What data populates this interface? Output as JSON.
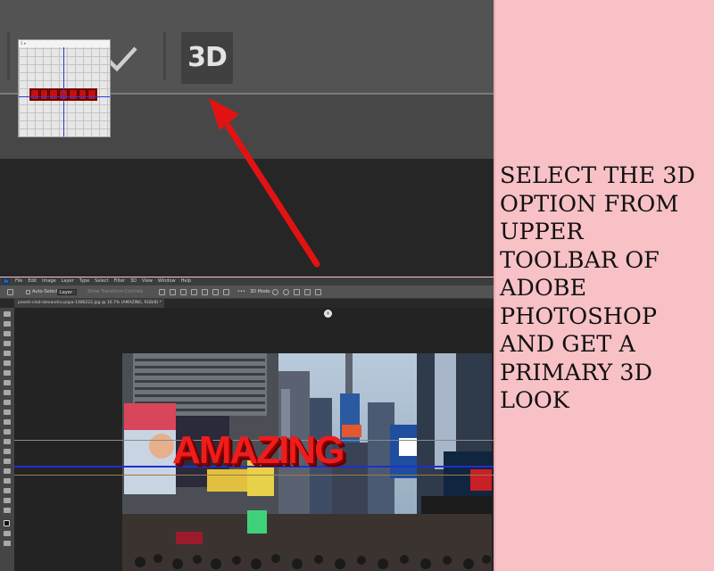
{
  "zoom_toolbar": {
    "btn_3d_label": "3D",
    "cancel_icon": "cancel-circle-icon",
    "commit_icon": "checkmark-icon",
    "arrow_color": "#e31212"
  },
  "photoshop": {
    "menu": [
      "File",
      "Edit",
      "Image",
      "Layer",
      "Type",
      "Select",
      "Filter",
      "3D",
      "View",
      "Window",
      "Help"
    ],
    "options_bar": {
      "auto_select_label": "Auto-Select:",
      "layer_value": "Layer",
      "transform_controls_label": "Show Transform Controls",
      "mode_3d_label": "3D Mode:"
    },
    "document_tab": "pexels-vlad-alexandru-popa-1486222.jpg @ 16.7% (AMAZING, RGB/8) *",
    "canvas_text": "AMAZING"
  },
  "instruction": {
    "lines": [
      "SELECT THE 3D",
      "OPTION FROM",
      "UPPER",
      "TOOLBAR OF",
      "ADOBE",
      "PHOTOSHOP",
      "AND GET A",
      "PRIMARY 3D",
      "LOOK"
    ]
  },
  "colors": {
    "background_pink": "#f8c1c6",
    "toolbar_gray": "#535353",
    "text_red": "#ef1c1c"
  }
}
